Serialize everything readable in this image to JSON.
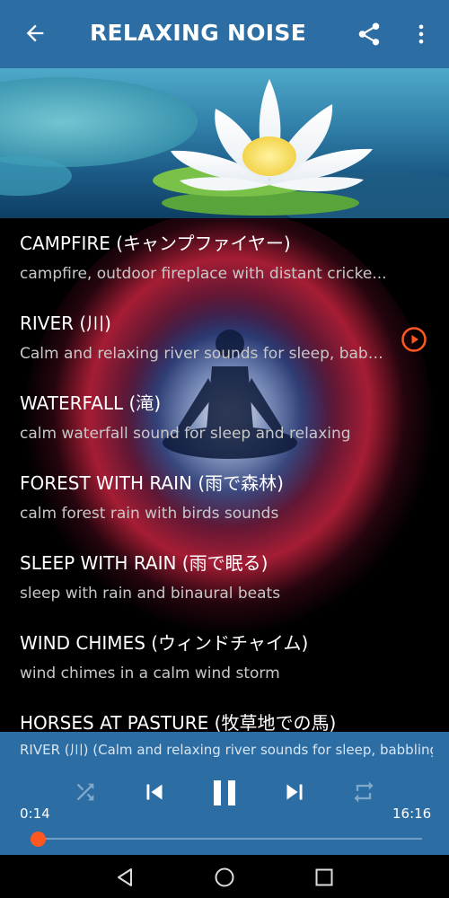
{
  "app": {
    "title": "RELAXING NOISE",
    "accent_color": "#2c6da4",
    "progress_color": "#ff5722"
  },
  "toolbar": {
    "back_icon": "arrow-back-icon",
    "share_icon": "share-icon",
    "more_icon": "more-vert-icon"
  },
  "tracks": [
    {
      "title": "CAMPFIRE (キャンプファイヤー)",
      "description": "campfire, outdoor fireplace with distant cricke..."
    },
    {
      "title": "RIVER (川)",
      "description": "Calm and relaxing river sounds for sleep, babb...",
      "playing": true
    },
    {
      "title": "WATERFALL (滝)",
      "description": "calm waterfall sound for sleep and relaxing"
    },
    {
      "title": "FOREST WITH RAIN (雨で森林)",
      "description": "calm forest rain with birds sounds"
    },
    {
      "title": "SLEEP WITH RAIN (雨で眠る)",
      "description": "sleep with rain and binaural beats"
    },
    {
      "title": "WIND CHIMES (ウィンドチャイム)",
      "description": "wind chimes in a calm wind storm"
    },
    {
      "title": "HORSES AT PASTURE (牧草地での馬)",
      "description": ""
    }
  ],
  "player": {
    "now_playing": "RIVER (川) (Calm and relaxing river sounds for sleep, babbling",
    "elapsed": "0:14",
    "duration": "16:16",
    "progress": 0.014,
    "controls": [
      "shuffle-icon",
      "skip-previous-icon",
      "pause-icon",
      "skip-next-icon",
      "repeat-icon"
    ]
  },
  "system_nav": [
    "back-triangle-icon",
    "home-circle-icon",
    "recents-square-icon"
  ]
}
